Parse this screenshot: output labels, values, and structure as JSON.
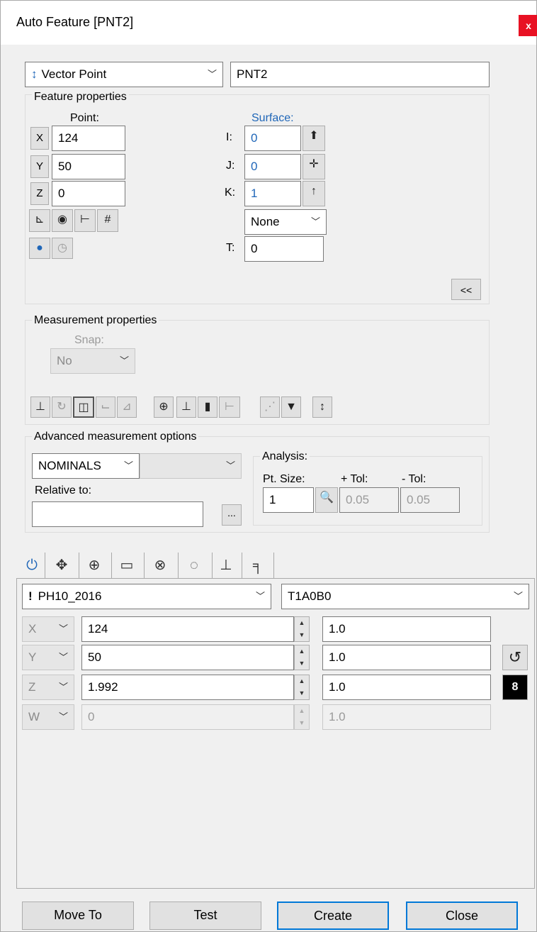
{
  "window": {
    "title": "Auto Feature [PNT2]",
    "close_glyph": "x"
  },
  "feature_type": {
    "value": "Vector Point",
    "icon": "vector-point-icon"
  },
  "feature_name": "PNT2",
  "feature_properties": {
    "label": "Feature properties",
    "point_label": "Point:",
    "surface_label": "Surface:",
    "x": {
      "axis": "X",
      "value": "124"
    },
    "y": {
      "axis": "Y",
      "value": "50"
    },
    "z": {
      "axis": "Z",
      "value": "0"
    },
    "i": {
      "label": "I:",
      "value": "0"
    },
    "j": {
      "label": "J:",
      "value": "0"
    },
    "k": {
      "label": "K:",
      "value": "1"
    },
    "none_select": "None",
    "t": {
      "label": "T:",
      "value": "0"
    },
    "collapse_label": "<<"
  },
  "measurement_properties": {
    "label": "Measurement properties",
    "snap_label": "Snap:",
    "snap_value": "No"
  },
  "advanced": {
    "label": "Advanced measurement options",
    "mode": "NOMINALS",
    "relative_to_label": "Relative to:",
    "browse_label": "...",
    "analysis_label": "Analysis:",
    "pt_size_label": "Pt. Size:",
    "plus_tol_label": "+ Tol:",
    "minus_tol_label": "- Tol:",
    "pt_size": "1",
    "plus_tol": "0.05",
    "minus_tol": "0.05"
  },
  "probe": {
    "probe_name": "PH10_2016",
    "tip_name": "T1A0B0",
    "rows": [
      {
        "axis": "X",
        "value": "124",
        "step": "1.0",
        "enabled": true
      },
      {
        "axis": "Y",
        "value": "50",
        "step": "1.0",
        "enabled": true
      },
      {
        "axis": "Z",
        "value": "1.992",
        "step": "1.0",
        "enabled": true
      },
      {
        "axis": "W",
        "value": "0",
        "step": "1.0",
        "enabled": false
      }
    ]
  },
  "buttons": {
    "move_to": "Move To",
    "test": "Test",
    "create": "Create",
    "close": "Close"
  },
  "colors": {
    "accent_blue": "#1f66b8",
    "close_red": "#e81123",
    "default_border": "#0078d7"
  }
}
